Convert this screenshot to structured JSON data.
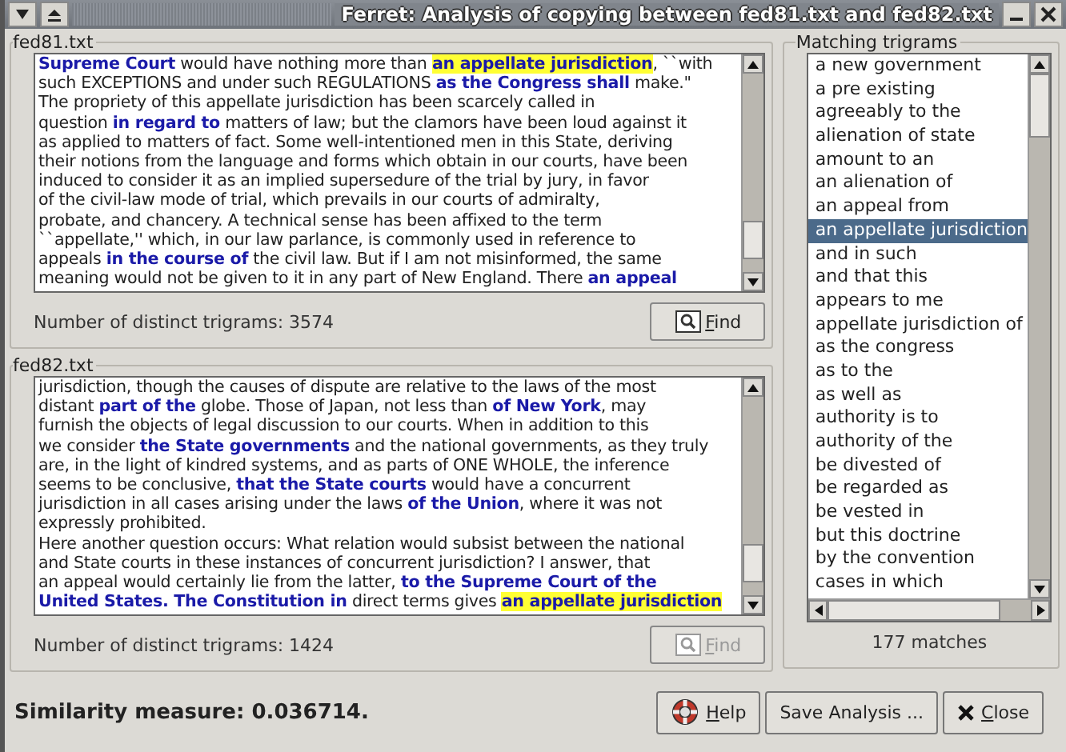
{
  "window": {
    "title": "Ferret: Analysis of copying between fed81.txt and fed82.txt"
  },
  "documents": [
    {
      "label": "fed81.txt",
      "trigram_count": "Number of distinct trigrams: 3574",
      "find_button": {
        "label": "Find",
        "disabled": false
      },
      "lines": [
        [
          {
            "text": "Supreme Court",
            "kind": "match"
          },
          {
            "text": " would have nothing more than ",
            "kind": "plain"
          },
          {
            "text": "an appellate jurisdiction",
            "kind": "selected_match"
          },
          {
            "text": ", ``with",
            "kind": "plain"
          }
        ],
        [
          {
            "text": "such EXCEPTIONS and under such REGULATIONS ",
            "kind": "plain"
          },
          {
            "text": "as the Congress shall",
            "kind": "match"
          },
          {
            "text": " make.\"",
            "kind": "plain"
          }
        ],
        [
          {
            "text": "The propriety of this appellate jurisdiction has been scarcely called in",
            "kind": "plain"
          }
        ],
        [
          {
            "text": "question ",
            "kind": "plain"
          },
          {
            "text": "in regard to",
            "kind": "match"
          },
          {
            "text": " matters of law; but the clamors have been loud against it",
            "kind": "plain"
          }
        ],
        [
          {
            "text": "as applied to matters of fact. Some well-intentioned men in this State, deriving",
            "kind": "plain"
          }
        ],
        [
          {
            "text": "their notions from the language and forms which obtain in our courts, have been",
            "kind": "plain"
          }
        ],
        [
          {
            "text": "induced to consider it as an implied supersedure of the trial by jury, in favor",
            "kind": "plain"
          }
        ],
        [
          {
            "text": "of the civil-law mode of trial, which prevails in our courts of admiralty,",
            "kind": "plain"
          }
        ],
        [
          {
            "text": "probate, and chancery. A technical sense has been affixed to the term",
            "kind": "plain"
          }
        ],
        [
          {
            "text": "``appellate,'' which, in our law parlance, is commonly used in reference to",
            "kind": "plain"
          }
        ],
        [
          {
            "text": "appeals ",
            "kind": "plain"
          },
          {
            "text": "in the course of",
            "kind": "match"
          },
          {
            "text": " the civil law. But if I am not misinformed, the same",
            "kind": "plain"
          }
        ],
        [
          {
            "text": "meaning would not be given to it in any part of New England. There ",
            "kind": "plain"
          },
          {
            "text": "an appeal",
            "kind": "match"
          }
        ]
      ]
    },
    {
      "label": "fed82.txt",
      "trigram_count": "Number of distinct trigrams: 1424",
      "find_button": {
        "label": "Find",
        "disabled": true
      },
      "lines": [
        [
          {
            "text": "jurisdiction, though the causes of dispute are relative to the laws of the most",
            "kind": "plain"
          }
        ],
        [
          {
            "text": "distant ",
            "kind": "plain"
          },
          {
            "text": "part of the",
            "kind": "match"
          },
          {
            "text": " globe. Those of Japan, not less than ",
            "kind": "plain"
          },
          {
            "text": "of New York",
            "kind": "match"
          },
          {
            "text": ", may",
            "kind": "plain"
          }
        ],
        [
          {
            "text": "furnish the objects of legal discussion to our courts. When in addition to this",
            "kind": "plain"
          }
        ],
        [
          {
            "text": "we consider ",
            "kind": "plain"
          },
          {
            "text": "the State governments",
            "kind": "match"
          },
          {
            "text": " and the national governments, as they truly",
            "kind": "plain"
          }
        ],
        [
          {
            "text": "are, in the light of kindred systems, and as parts of ONE WHOLE, the inference",
            "kind": "plain"
          }
        ],
        [
          {
            "text": "seems to be conclusive, ",
            "kind": "plain"
          },
          {
            "text": "that the State courts",
            "kind": "match"
          },
          {
            "text": " would have a concurrent",
            "kind": "plain"
          }
        ],
        [
          {
            "text": "jurisdiction in all cases arising under the laws ",
            "kind": "plain"
          },
          {
            "text": "of the Union",
            "kind": "match"
          },
          {
            "text": ", where it was not",
            "kind": "plain"
          }
        ],
        [
          {
            "text": "expressly prohibited.",
            "kind": "plain"
          }
        ],
        [
          {
            "text": "Here another question occurs: What relation would subsist between the national",
            "kind": "plain"
          }
        ],
        [
          {
            "text": "and State courts in these instances of concurrent jurisdiction? I answer, that",
            "kind": "plain"
          }
        ],
        [
          {
            "text": "an appeal would certainly lie from the latter, ",
            "kind": "plain"
          },
          {
            "text": "to the Supreme Court of the",
            "kind": "match"
          }
        ],
        [
          {
            "text": "United States. The Constitution in",
            "kind": "match"
          },
          {
            "text": " direct terms gives ",
            "kind": "plain"
          },
          {
            "text": "an appellate jurisdiction",
            "kind": "selected_match"
          }
        ]
      ]
    }
  ],
  "trigrams": {
    "label": "Matching trigrams",
    "count": "177 matches",
    "items": [
      {
        "text": "a new government",
        "selected": false
      },
      {
        "text": "a pre existing",
        "selected": false
      },
      {
        "text": "agreeably to the",
        "selected": false
      },
      {
        "text": "alienation of state",
        "selected": false
      },
      {
        "text": "amount to an",
        "selected": false
      },
      {
        "text": "an alienation of",
        "selected": false
      },
      {
        "text": "an appeal from",
        "selected": false
      },
      {
        "text": "an appellate jurisdiction",
        "selected": true
      },
      {
        "text": "and in such",
        "selected": false
      },
      {
        "text": "and that this",
        "selected": false
      },
      {
        "text": "appears to me",
        "selected": false
      },
      {
        "text": "appellate jurisdiction of",
        "selected": false
      },
      {
        "text": "as the congress",
        "selected": false
      },
      {
        "text": "as to the",
        "selected": false
      },
      {
        "text": "as well as",
        "selected": false
      },
      {
        "text": "authority is to",
        "selected": false
      },
      {
        "text": "authority of the",
        "selected": false
      },
      {
        "text": "be divested of",
        "selected": false
      },
      {
        "text": "be regarded as",
        "selected": false
      },
      {
        "text": "be vested in",
        "selected": false
      },
      {
        "text": "but this doctrine",
        "selected": false
      },
      {
        "text": "by the convention",
        "selected": false
      },
      {
        "text": "cases in which",
        "selected": false
      }
    ]
  },
  "similarity": "Similarity measure: 0.036714.",
  "buttons": [
    {
      "kind": "help",
      "label": "Help"
    },
    {
      "kind": "save",
      "label": "Save Analysis ..."
    },
    {
      "kind": "close",
      "label": "Close"
    }
  ]
}
